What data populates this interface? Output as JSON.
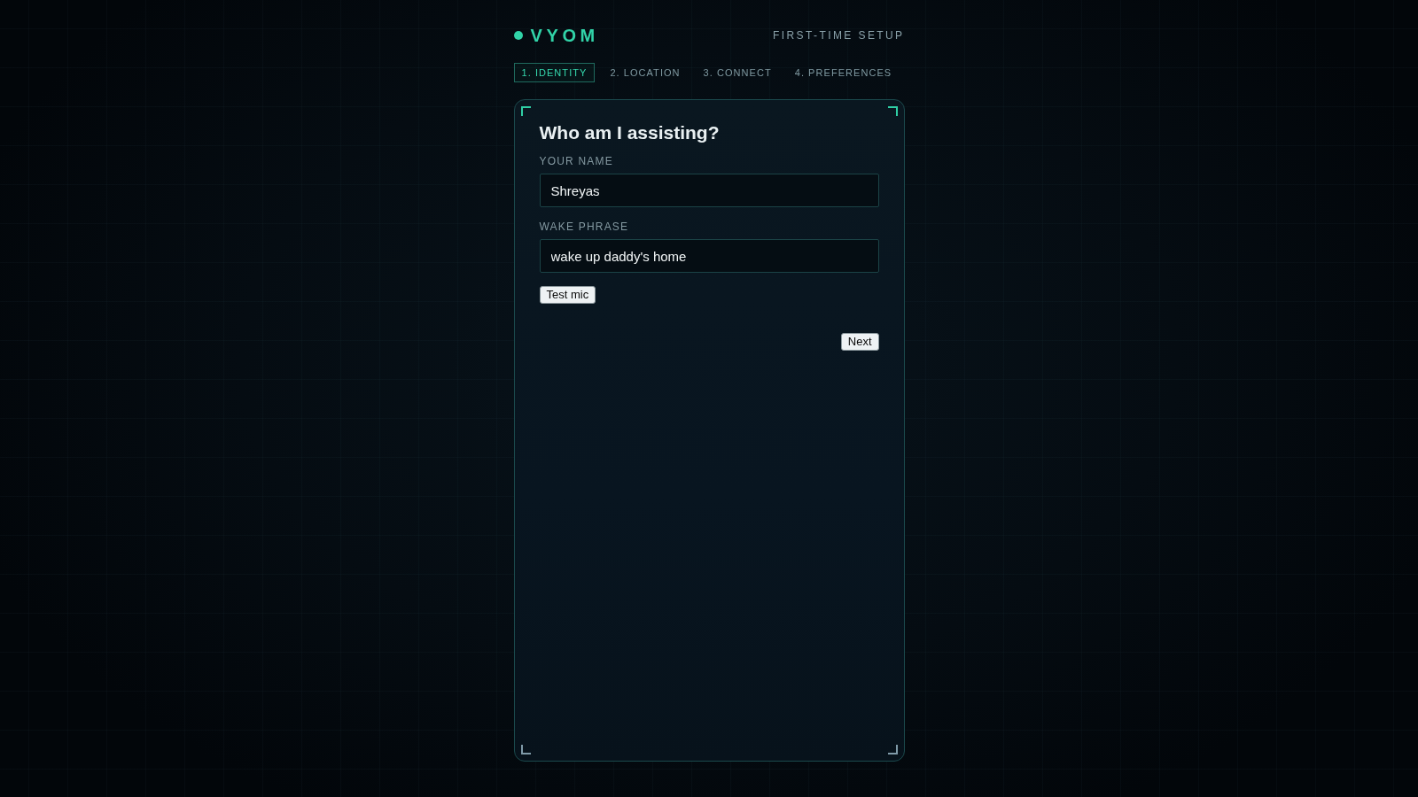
{
  "header": {
    "brand": "VYOM",
    "subtitle": "FIRST-TIME SETUP"
  },
  "steps": [
    {
      "label": "1. IDENTITY",
      "selected": true
    },
    {
      "label": "2. LOCATION",
      "selected": false
    },
    {
      "label": "3. CONNECT",
      "selected": false
    },
    {
      "label": "4. PREFERENCES",
      "selected": false
    }
  ],
  "card": {
    "title": "Who am I assisting?",
    "fields": [
      {
        "label": "YOUR NAME",
        "value": "Shreyas"
      },
      {
        "label": "WAKE PHRASE",
        "value": "wake up daddy's home"
      }
    ],
    "test_button": "Test mic",
    "next_button": "Next"
  }
}
